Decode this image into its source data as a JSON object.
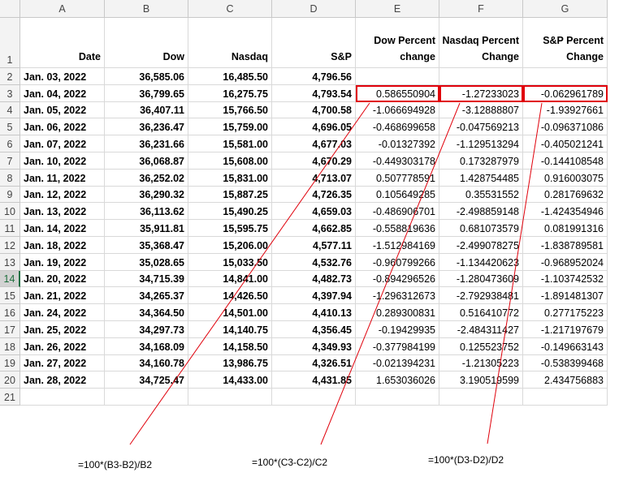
{
  "columns": [
    "A",
    "B",
    "C",
    "D",
    "E",
    "F",
    "G"
  ],
  "header_row": {
    "row_number": "1",
    "labels": [
      [
        "Date"
      ],
      [
        "Dow"
      ],
      [
        "Nasdaq"
      ],
      [
        "S&P"
      ],
      [
        "Dow Percent",
        "change"
      ],
      [
        "Nasdaq Percent",
        "Change"
      ],
      [
        "S&P Percent",
        "Change"
      ]
    ]
  },
  "rows": [
    {
      "n": "2",
      "date": "Jan. 03, 2022",
      "dow": "36,585.06",
      "nasdaq": "16,485.50",
      "sp": "4,796.56",
      "e": "",
      "f": "",
      "g": ""
    },
    {
      "n": "3",
      "date": "Jan. 04, 2022",
      "dow": "36,799.65",
      "nasdaq": "16,275.75",
      "sp": "4,793.54",
      "e": "0.586550904",
      "f": "-1.27233023",
      "g": "-0.062961789"
    },
    {
      "n": "4",
      "date": "Jan. 05, 2022",
      "dow": "36,407.11",
      "nasdaq": "15,766.50",
      "sp": "4,700.58",
      "e": "-1.066694928",
      "f": "-3.12888807",
      "g": "-1.93927661"
    },
    {
      "n": "5",
      "date": "Jan. 06, 2022",
      "dow": "36,236.47",
      "nasdaq": "15,759.00",
      "sp": "4,696.05",
      "e": "-0.468699658",
      "f": "-0.047569213",
      "g": "-0.096371086"
    },
    {
      "n": "6",
      "date": "Jan. 07, 2022",
      "dow": "36,231.66",
      "nasdaq": "15,581.00",
      "sp": "4,677.03",
      "e": "-0.01327392",
      "f": "-1.129513294",
      "g": "-0.405021241"
    },
    {
      "n": "7",
      "date": "Jan. 10, 2022",
      "dow": "36,068.87",
      "nasdaq": "15,608.00",
      "sp": "4,670.29",
      "e": "-0.449303178",
      "f": "0.173287979",
      "g": "-0.144108548"
    },
    {
      "n": "8",
      "date": "Jan. 11, 2022",
      "dow": "36,252.02",
      "nasdaq": "15,831.00",
      "sp": "4,713.07",
      "e": "0.507778591",
      "f": "1.428754485",
      "g": "0.916003075"
    },
    {
      "n": "9",
      "date": "Jan. 12, 2022",
      "dow": "36,290.32",
      "nasdaq": "15,887.25",
      "sp": "4,726.35",
      "e": "0.105649285",
      "f": "0.35531552",
      "g": "0.281769632"
    },
    {
      "n": "10",
      "date": "Jan. 13, 2022",
      "dow": "36,113.62",
      "nasdaq": "15,490.25",
      "sp": "4,659.03",
      "e": "-0.486906701",
      "f": "-2.498859148",
      "g": "-1.424354946"
    },
    {
      "n": "11",
      "date": "Jan. 14, 2022",
      "dow": "35,911.81",
      "nasdaq": "15,595.75",
      "sp": "4,662.85",
      "e": "-0.558819636",
      "f": "0.681073579",
      "g": "0.081991316"
    },
    {
      "n": "12",
      "date": "Jan. 18, 2022",
      "dow": "35,368.47",
      "nasdaq": "15,206.00",
      "sp": "4,577.11",
      "e": "-1.512984169",
      "f": "-2.499078275",
      "g": "-1.838789581"
    },
    {
      "n": "13",
      "date": "Jan. 19, 2022",
      "dow": "35,028.65",
      "nasdaq": "15,033.50",
      "sp": "4,532.76",
      "e": "-0.960799266",
      "f": "-1.134420623",
      "g": "-0.968952024"
    },
    {
      "n": "14",
      "date": "Jan. 20, 2022",
      "dow": "34,715.39",
      "nasdaq": "14,841.00",
      "sp": "4,482.73",
      "e": "-0.894296526",
      "f": "-1.280473609",
      "g": "-1.103742532"
    },
    {
      "n": "15",
      "date": "Jan. 21, 2022",
      "dow": "34,265.37",
      "nasdaq": "14,426.50",
      "sp": "4,397.94",
      "e": "-1.296312673",
      "f": "-2.792938481",
      "g": "-1.891481307"
    },
    {
      "n": "16",
      "date": "Jan. 24, 2022",
      "dow": "34,364.50",
      "nasdaq": "14,501.00",
      "sp": "4,410.13",
      "e": "0.289300831",
      "f": "0.516410772",
      "g": "0.277175223"
    },
    {
      "n": "17",
      "date": "Jan. 25, 2022",
      "dow": "34,297.73",
      "nasdaq": "14,140.75",
      "sp": "4,356.45",
      "e": "-0.19429935",
      "f": "-2.484311427",
      "g": "-1.217197679"
    },
    {
      "n": "18",
      "date": "Jan. 26, 2022",
      "dow": "34,168.09",
      "nasdaq": "14,158.50",
      "sp": "4,349.93",
      "e": "-0.377984199",
      "f": "0.125523752",
      "g": "-0.149663143"
    },
    {
      "n": "19",
      "date": "Jan. 27, 2022",
      "dow": "34,160.78",
      "nasdaq": "13,986.75",
      "sp": "4,326.51",
      "e": "-0.021394231",
      "f": "-1.21305223",
      "g": "-0.538399468"
    },
    {
      "n": "20",
      "date": "Jan. 28, 2022",
      "dow": "34,725.47",
      "nasdaq": "14,433.00",
      "sp": "4,431.85",
      "e": "1.653036026",
      "f": "3.190519599",
      "g": "2.434756883"
    },
    {
      "n": "21",
      "date": "",
      "dow": "",
      "nasdaq": "",
      "sp": "",
      "e": "",
      "f": "",
      "g": ""
    }
  ],
  "selected_row": "14",
  "highlight_color": "#e0000b",
  "annotations": {
    "dow_formula": "=100*(B3-B2)/B2",
    "nasdaq_formula": "=100*(C3-C2)/C2",
    "sp_formula": "=100*(D3-D2)/D2"
  }
}
